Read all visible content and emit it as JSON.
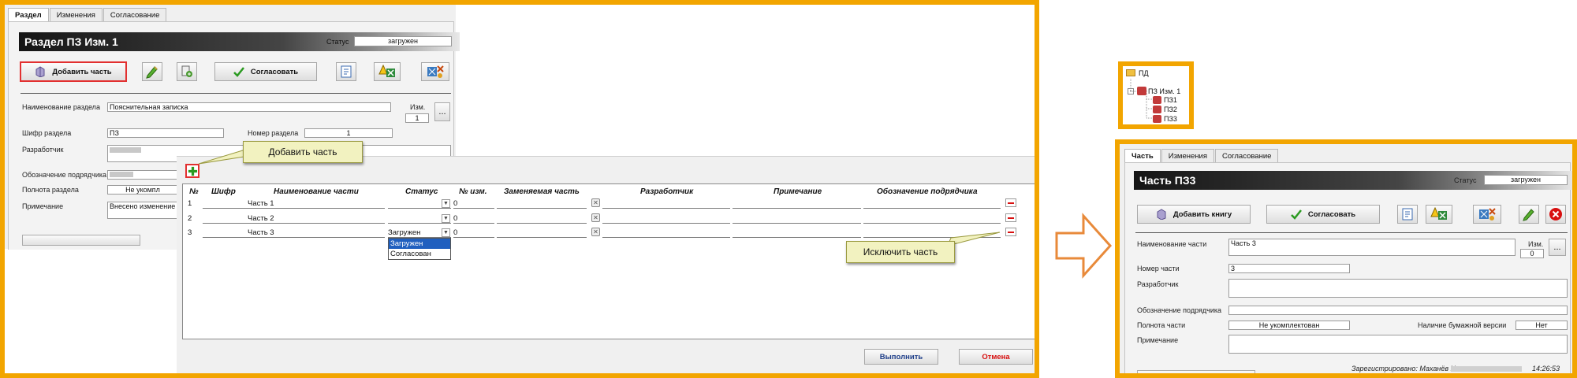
{
  "left": {
    "tabs": [
      "Раздел",
      "Изменения",
      "Согласование"
    ],
    "title": "Раздел  ПЗ Изм. 1",
    "status_label": "Статус",
    "status_value": "загружен",
    "add_part_button": "Добавить часть",
    "approve_button": "Согласовать",
    "fields": {
      "name_label": "Наименование раздела",
      "name_value": "Пояснительная записка",
      "rev_label": "Изм.",
      "rev_value": "1",
      "cipher_label": "Шифр раздела",
      "cipher_value": "ПЗ",
      "number_label": "Номер раздела",
      "number_value": "1",
      "developer_label": "Разработчик",
      "contractor_label": "Обозначение подрядчика",
      "completeness_label": "Полнота раздела",
      "completeness_value": "Не укомпл",
      "note_label": "Примечание",
      "note_value": "Внесено изменение"
    },
    "ellipsis": "..."
  },
  "dialog": {
    "headers": [
      "№",
      "Шифр",
      "Наименование части",
      "Статус",
      "№ изм.",
      "Заменяемая часть",
      "Разработчик",
      "Примечание",
      "Обозначение подрядчика"
    ],
    "rows": [
      {
        "num": "1",
        "name": "Часть 1",
        "status": "",
        "rev": "0"
      },
      {
        "num": "2",
        "name": "Часть 2",
        "status": "",
        "rev": "0"
      },
      {
        "num": "3",
        "name": "Часть 3",
        "status": "Загружен",
        "rev": "0"
      }
    ],
    "dropdown_options": [
      "Загружен",
      "Согласован"
    ],
    "execute_button": "Выполнить",
    "cancel_button": "Отмена",
    "callout_add": "Добавить часть",
    "callout_exclude": "Исключить часть"
  },
  "tree": {
    "root": "ПД",
    "child": "ПЗ Изм. 1",
    "leaves": [
      "ПЗ1",
      "ПЗ2",
      "ПЗ3"
    ]
  },
  "right": {
    "tabs": [
      "Часть",
      "Изменения",
      "Согласование"
    ],
    "title": "Часть ПЗ3",
    "status_label": "Статус",
    "status_value": "загружен",
    "add_book_button": "Добавить книгу",
    "approve_button": "Согласовать",
    "fields": {
      "name_label": "Наименование части",
      "name_value": "Часть 3",
      "rev_label": "Изм.",
      "rev_value": "0",
      "number_label": "Номер части",
      "number_value": "3",
      "developer_label": "Разработчик",
      "contractor_label": "Обозначение подрядчика",
      "completeness_label": "Полнота части",
      "completeness_value": "Не укомплектован",
      "paper_label": "Наличие бумажной версии",
      "paper_value": "Нет",
      "note_label": "Примечание"
    },
    "ellipsis": "...",
    "registered_label": "Зарегистрировано: Маханёв Н",
    "registered_time": "14:26:53"
  },
  "colors": {
    "frame": "#f2a500",
    "arrow": "#e88a3a",
    "accent_red": "#d81010",
    "callout_bg": "#f2f2c0",
    "highlight_blue": "#1f5fbf"
  }
}
